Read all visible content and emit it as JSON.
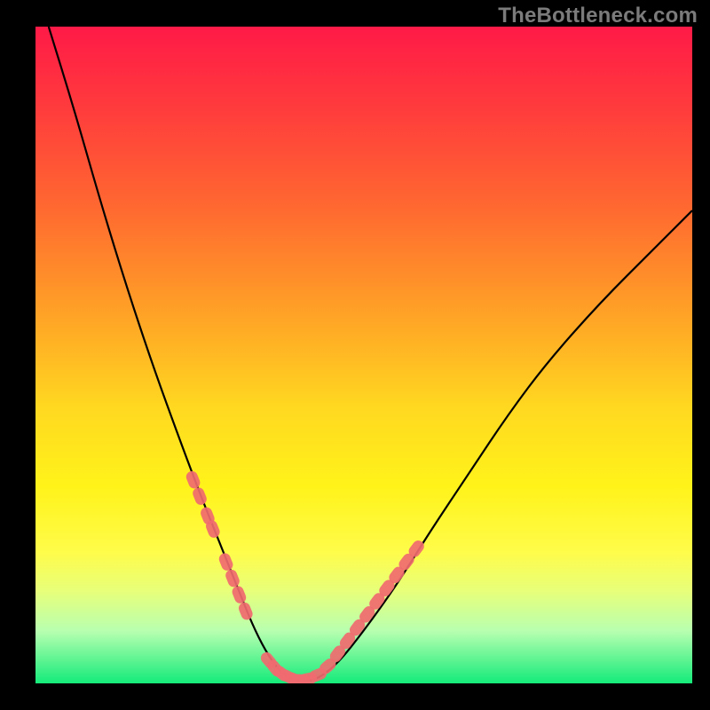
{
  "watermark": "TheBottleneck.com",
  "chart_data": {
    "type": "line",
    "title": "",
    "xlabel": "",
    "ylabel": "",
    "xlim": [
      0,
      100
    ],
    "ylim": [
      0,
      100
    ],
    "grid": false,
    "legend": "none",
    "series": [
      {
        "name": "bottleneck-curve",
        "color": "#000000",
        "x": [
          2,
          6,
          10,
          14,
          18,
          22,
          25,
          27,
          29,
          31,
          33,
          35,
          37,
          39,
          41,
          43,
          46,
          50,
          55,
          60,
          66,
          72,
          78,
          86,
          94,
          100
        ],
        "y": [
          100,
          87,
          73,
          60,
          48,
          37,
          29,
          24,
          19,
          14,
          9,
          5,
          2,
          0.6,
          0.3,
          0.7,
          3,
          8,
          15,
          23,
          32,
          41,
          49,
          58,
          66,
          72
        ]
      },
      {
        "name": "highlight-dots-left",
        "color": "#f06a6f",
        "x": [
          24.0,
          25.0,
          26.2,
          27.0,
          29.0,
          30.0,
          31.0,
          32.0
        ],
        "y": [
          31.0,
          28.5,
          25.5,
          23.5,
          18.5,
          16.0,
          13.5,
          11.0
        ]
      },
      {
        "name": "highlight-dots-bottom",
        "color": "#f06a6f",
        "x": [
          35.5,
          36.5,
          37.5,
          38.5,
          39.5,
          40.5,
          41.5,
          43.0,
          44.5
        ],
        "y": [
          3.5,
          2.3,
          1.5,
          1.0,
          0.6,
          0.5,
          0.7,
          1.3,
          2.6
        ]
      },
      {
        "name": "highlight-dots-right",
        "color": "#f06a6f",
        "x": [
          46.0,
          47.5,
          49.0,
          50.5,
          52.0,
          53.5,
          55.0,
          56.5,
          58.0
        ],
        "y": [
          4.5,
          6.5,
          8.5,
          10.5,
          12.5,
          14.5,
          16.5,
          18.5,
          20.5
        ]
      }
    ]
  }
}
